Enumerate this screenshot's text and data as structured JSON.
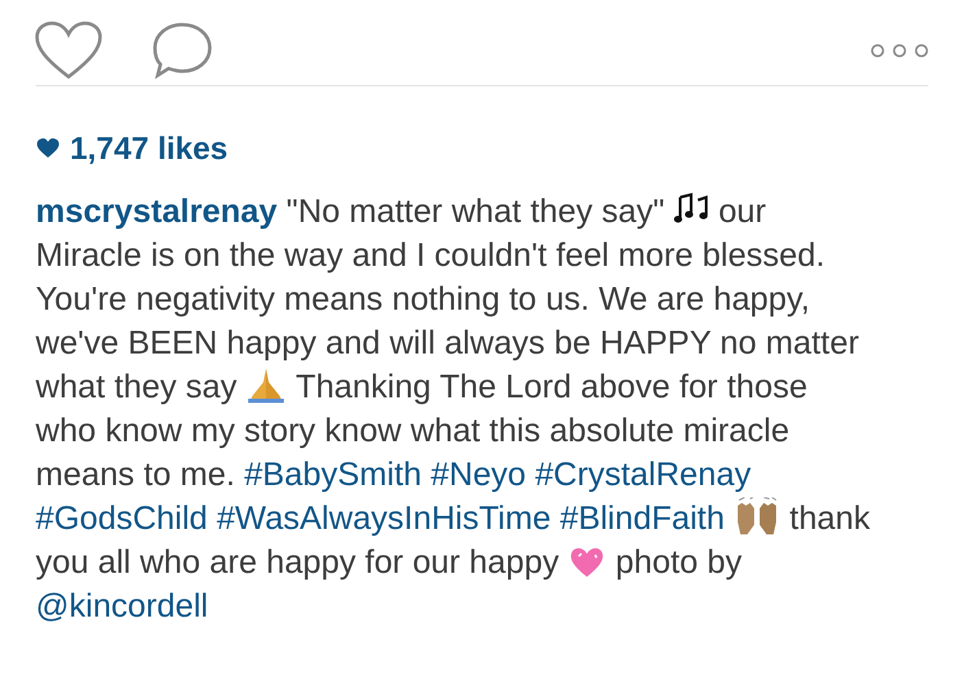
{
  "likes": {
    "count": "1,747 likes"
  },
  "caption": [
    {
      "kind": "user",
      "text": "mscrystalrenay"
    },
    {
      "kind": "text",
      "text": " \"No matter what they say\" "
    },
    {
      "kind": "notes"
    },
    {
      "kind": "text",
      "text": " our Miracle is on the way and I couldn't feel more blessed. You're negativity means nothing to us. We are happy, we've BEEN happy and will always be HAPPY no matter what they say "
    },
    {
      "kind": "hands"
    },
    {
      "kind": "text",
      "text": " Thanking The Lord above for those who know my story know what this absolute miracle means to me. "
    },
    {
      "kind": "tag",
      "text": "#BabySmith"
    },
    {
      "kind": "tag",
      "text": "#Neyo"
    },
    {
      "kind": "tag",
      "text": "#CrystalRenay"
    },
    {
      "kind": "tag",
      "text": "#GodsChild"
    },
    {
      "kind": "tag",
      "text": "#WasAlwaysInHisTime"
    },
    {
      "kind": "tag",
      "text": "#BlindFaith"
    },
    {
      "kind": "raised"
    },
    {
      "kind": "text",
      "text": " thank you all who are happy for our happy "
    },
    {
      "kind": "heart"
    },
    {
      "kind": "text",
      "text": " photo by "
    },
    {
      "kind": "tag",
      "text": "@kincordell"
    }
  ]
}
